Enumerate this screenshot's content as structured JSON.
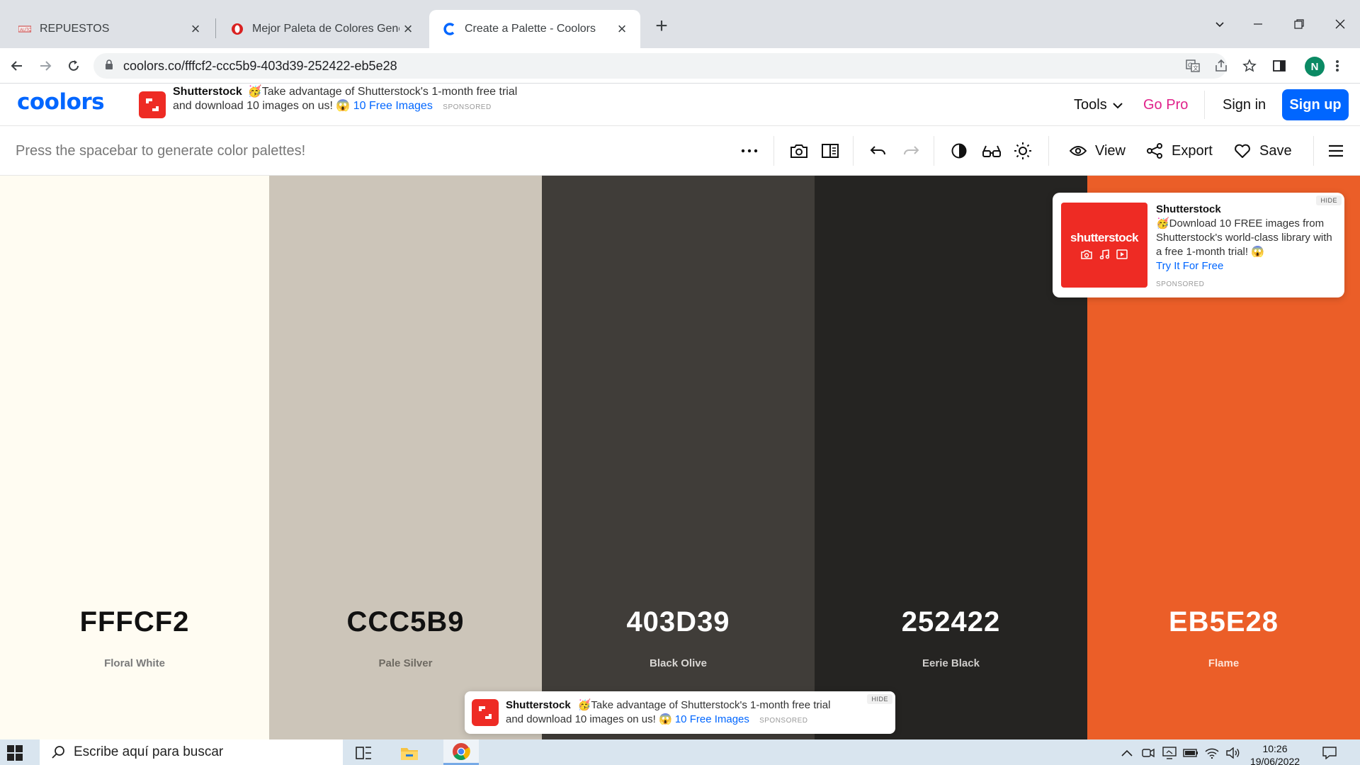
{
  "browser": {
    "tabs": [
      {
        "title": "REPUESTOS",
        "active": false
      },
      {
        "title": "Mejor Paleta de Colores Generad",
        "active": false
      },
      {
        "title": "Create a Palette - Coolors",
        "active": true
      }
    ],
    "url": "coolors.co/fffcf2-ccc5b9-403d39-252422-eb5e28",
    "profile_initial": "N"
  },
  "header": {
    "logo": "coolors",
    "ad": {
      "brand": "Shutterstock",
      "text_line1": "🥳Take advantage of Shutterstock's 1-month free trial",
      "text_line2": "and download 10 images on us! 😱",
      "cta": "10 Free Images",
      "sponsored": "SPONSORED"
    },
    "tools_label": "Tools",
    "go_pro_label": "Go Pro",
    "sign_in_label": "Sign in",
    "sign_up_label": "Sign up"
  },
  "palette_toolbar": {
    "hint": "Press the spacebar to generate color palettes!",
    "view_label": "View",
    "export_label": "Export",
    "save_label": "Save"
  },
  "palette": [
    {
      "hex": "FFFCF2",
      "name": "Floral White",
      "color": "#fffcf2",
      "text_color": "#111111",
      "name_color": "#7a7a7a"
    },
    {
      "hex": "CCC5B9",
      "name": "Pale Silver",
      "color": "#ccc5b9",
      "text_color": "#111111",
      "name_color": "#6e6a62"
    },
    {
      "hex": "403D39",
      "name": "Black Olive",
      "color": "#403d39",
      "text_color": "#ffffff",
      "name_color": "#d9d7d4"
    },
    {
      "hex": "252422",
      "name": "Eerie Black",
      "color": "#252422",
      "text_color": "#ffffff",
      "name_color": "#cfcdcb"
    },
    {
      "hex": "EB5E28",
      "name": "Flame",
      "color": "#eb5e28",
      "text_color": "#ffffff",
      "name_color": "#fde2d6"
    }
  ],
  "side_ad": {
    "image_word": "shutterstock",
    "brand": "Shutterstock",
    "text": "🥳Download 10 FREE images from Shutterstock's world-class library with a free 1-month trial! 😱",
    "cta": "Try It For Free",
    "sponsored": "SPONSORED",
    "hide": "HIDE"
  },
  "bottom_ad": {
    "brand": "Shutterstock",
    "text_line1": "🥳Take advantage of Shutterstock's 1-month free trial",
    "text_line2": "and download 10 images on us! 😱",
    "cta": "10 Free Images",
    "sponsored": "SPONSORED",
    "hide": "HIDE"
  },
  "taskbar": {
    "search_placeholder": "Escribe aquí para buscar",
    "time": "10:26",
    "date": "19/06/2022"
  },
  "colors": {
    "accent": "#0066ff",
    "go_pro": "#e0218a",
    "shutterstock_red": "#ee2b24"
  }
}
